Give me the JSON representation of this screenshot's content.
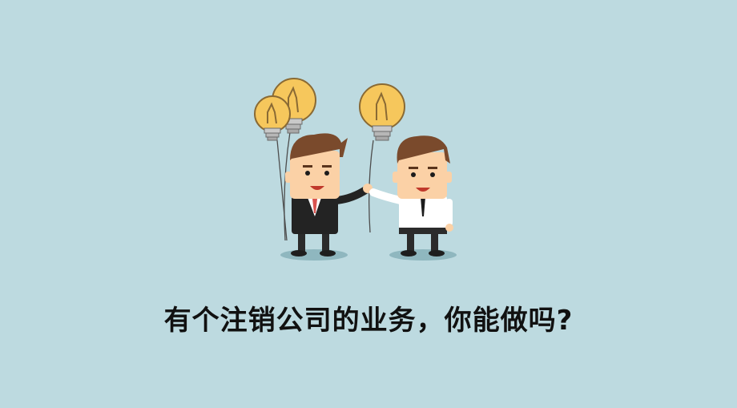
{
  "caption": "有个注销公司的业务，你能做吗?",
  "colors": {
    "background": "#bddae0",
    "bulb": "#f6c75c",
    "suit": "#232323",
    "shirt": "#ffffff",
    "skin": "#fbd1a6",
    "hair": "#7a4a2c"
  },
  "icons": [
    "lightbulb-icon",
    "lightbulb-icon",
    "lightbulb-icon"
  ]
}
